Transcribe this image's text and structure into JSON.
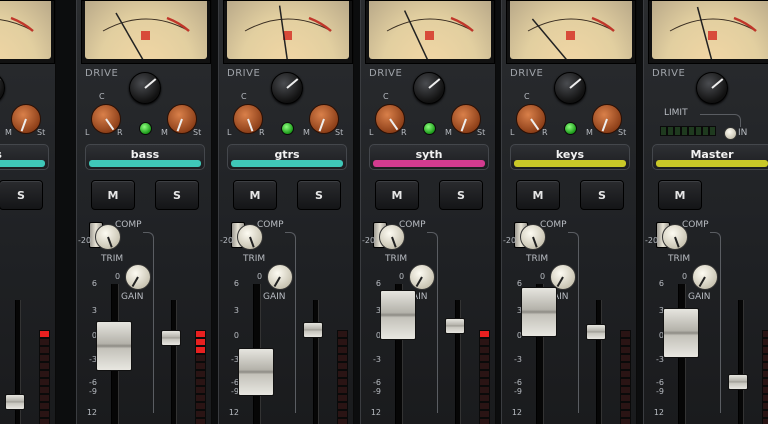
{
  "colors": {
    "teal": "#3fc7b8",
    "magenta": "#d33b8f",
    "yellow": "#c9c828",
    "led_red": "#e82020",
    "led_green": "#3be03a"
  },
  "labels": {
    "drive": "DRIVE",
    "comp": "COMP",
    "trim": "TRIM",
    "gain": "GAIN",
    "minus20": "-20",
    "zero": "0",
    "c": "C",
    "l": "L",
    "r": "R",
    "m": "M",
    "st": "St",
    "limit": "LIMIT",
    "in": "IN"
  },
  "buttons": {
    "mute": "M",
    "solo": "S"
  },
  "scale": [
    "6",
    "3",
    "0",
    "-3",
    "-6",
    "-9",
    "12"
  ],
  "meter_icon": "vu-meter-logo-icon",
  "channels": [
    {
      "name": "ums",
      "color": "#3fc7b8",
      "fader_level": 0.1,
      "peak_red": 1,
      "comp_led": true
    },
    {
      "name": "bass",
      "color": "#3fc7b8",
      "fader_level": 0.55,
      "peak_red": 3,
      "comp_led": true
    },
    {
      "name": "gtrs",
      "color": "#3fc7b8",
      "fader_level": 0.35,
      "peak_red": 0,
      "comp_led": false
    },
    {
      "name": "syth",
      "color": "#d33b8f",
      "fader_level": 0.78,
      "peak_red": 1,
      "comp_led": true
    },
    {
      "name": "keys",
      "color": "#c9c828",
      "fader_level": 0.8,
      "peak_red": 0,
      "comp_led": false
    },
    {
      "name": "Master",
      "color": "#c9c828",
      "fader_level": 0.65,
      "peak_red": 0,
      "comp_led": true
    }
  ]
}
